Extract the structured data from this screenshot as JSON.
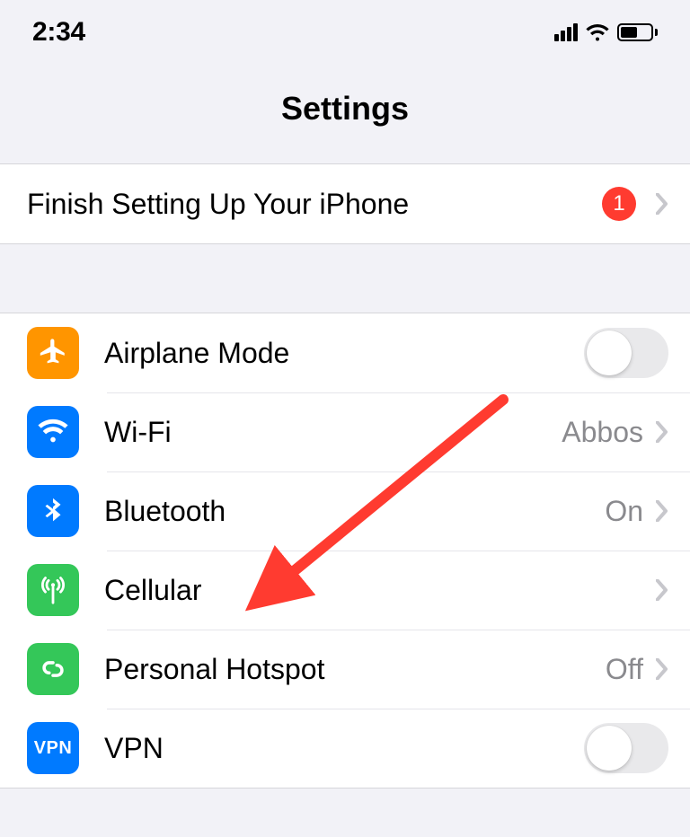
{
  "status": {
    "time": "2:34"
  },
  "page": {
    "title": "Settings"
  },
  "setup_row": {
    "label": "Finish Setting Up Your iPhone",
    "badge": "1"
  },
  "rows": {
    "airplane": {
      "label": "Airplane Mode",
      "icon_color": "#ff9500",
      "toggle_on": false
    },
    "wifi": {
      "label": "Wi-Fi",
      "value": "Abbos",
      "icon_color": "#007aff"
    },
    "bluetooth": {
      "label": "Bluetooth",
      "value": "On",
      "icon_color": "#007aff"
    },
    "cellular": {
      "label": "Cellular",
      "icon_color": "#34c759"
    },
    "hotspot": {
      "label": "Personal Hotspot",
      "value": "Off",
      "icon_color": "#34c759"
    },
    "vpn": {
      "label": "VPN",
      "icon_text": "VPN",
      "icon_color": "#007aff",
      "toggle_on": false
    }
  },
  "annotation": {
    "arrow_color": "#ff3b30"
  }
}
